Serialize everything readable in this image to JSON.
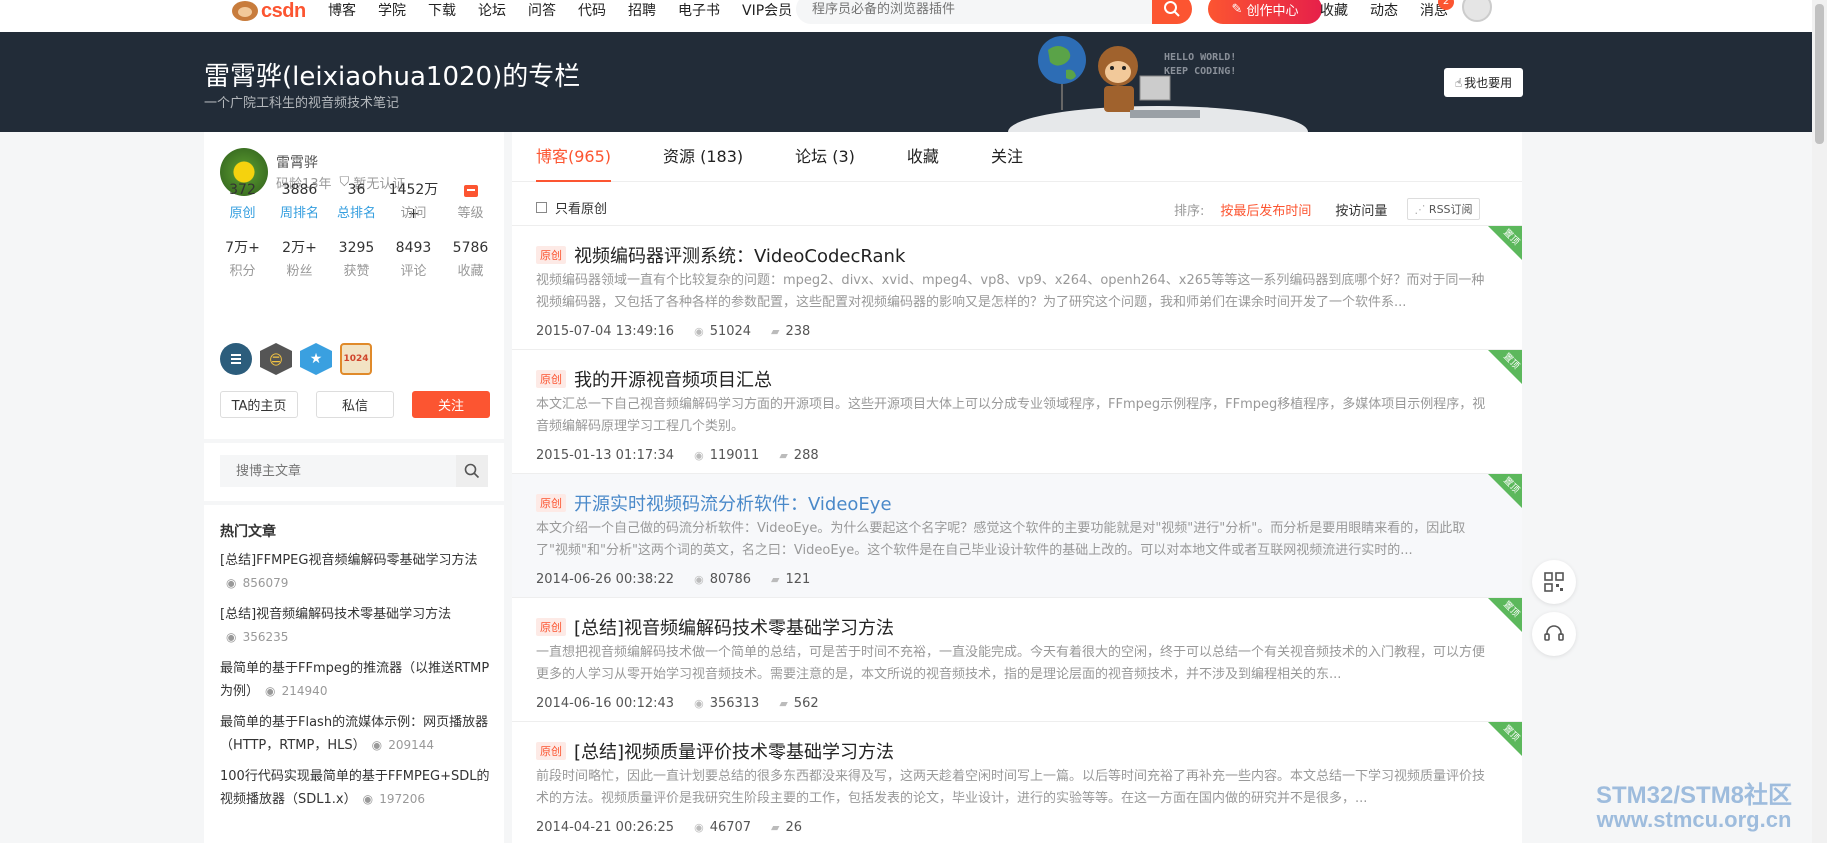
{
  "topbar": {
    "logo_text": "csdn",
    "nav": [
      "博客",
      "学院",
      "下载",
      "论坛",
      "问答",
      "代码",
      "招聘",
      "电子书",
      "VIP会员"
    ],
    "search_placeholder": "程序员必备的浏览器插件",
    "create_label": "创作中心",
    "right": [
      "收藏",
      "动态",
      "消息"
    ],
    "msg_count": "2"
  },
  "banner": {
    "title": "雷霄骅(leixiaohua1020)的专栏",
    "subtitle": "一个广院工科生的视音频技术笔记",
    "art_line1": "HELLO WORLD!",
    "art_line2": "KEEP CODING!",
    "btn": "我也要用"
  },
  "profile": {
    "name": "雷霄骅",
    "years": "码龄13年",
    "cert": "暂无认证",
    "stats1": [
      {
        "n": "372",
        "l": "原创"
      },
      {
        "n": "3886",
        "l": "周排名"
      },
      {
        "n": "36",
        "l": "总排名"
      },
      {
        "n": "1452万+",
        "l": "访问"
      },
      {
        "n": "",
        "l": "等级"
      }
    ],
    "stats2": [
      {
        "n": "7万+",
        "l": "积分"
      },
      {
        "n": "2万+",
        "l": "粉丝"
      },
      {
        "n": "3295",
        "l": "获赞"
      },
      {
        "n": "8493",
        "l": "评论"
      },
      {
        "n": "5786",
        "l": "收藏"
      }
    ],
    "btn_home": "TA的主页",
    "btn_msg": "私信",
    "btn_follow": "关注"
  },
  "blog_search": {
    "placeholder": "搜博主文章"
  },
  "hot": {
    "title": "热门文章",
    "items": [
      {
        "t": "[总结]FFMPEG视音频编解码零基础学习方法",
        "v": "856079"
      },
      {
        "t": "[总结]视音频编解码技术零基础学习方法",
        "v": "356235"
      },
      {
        "t": "最简单的基于FFmpeg的推流器（以推送RTMP为例）",
        "v": "214940"
      },
      {
        "t": "最简单的基于Flash的流媒体示例：网页播放器（HTTP，RTMP，HLS）",
        "v": "209144"
      },
      {
        "t": "100行代码实现最简单的基于FFMPEG+SDL的视频播放器（SDL1.x）",
        "v": "197206"
      }
    ]
  },
  "tabs": [
    "博客(965)",
    "资源 (183)",
    "论坛 (3)",
    "收藏",
    "关注"
  ],
  "filter": {
    "only_original": "只看原创",
    "sort_label": "排序:",
    "sort_active": "按最后发布时间",
    "sort_other": "按访问量",
    "rss": "RSS订阅"
  },
  "articles": [
    {
      "tag": "原创",
      "title": "视频编码器评测系统：VideoCodecRank",
      "desc": "视频编码器领域一直有个比较复杂的问题：mpeg2、divx、xvid、mpeg4、vp8、vp9、x264、openh264、x265等等这一系列编码器到底哪个好？而对于同一种视频编码器，又包括了各种各样的参数配置，这些配置对视频编码器的影响又是怎样的？为了研究这个问题，我和师弟们在课余时间开发了一个软件系...",
      "date": "2015-07-04 13:49:16",
      "views": "51024",
      "comments": "238",
      "corner": "置顶"
    },
    {
      "tag": "原创",
      "title": "我的开源视音频项目汇总",
      "desc": "本文汇总一下自己视音频编解码学习方面的开源项目。这些开源项目大体上可以分成专业领域程序，FFmpeg示例程序，FFmpeg移植程序，多媒体项目示例程序，视音频编解码原理学习工程几个类别。",
      "date": "2015-01-13 01:17:34",
      "views": "119011",
      "comments": "288",
      "corner": "置顶"
    },
    {
      "tag": "原创",
      "title": "开源实时视频码流分析软件：VideoEye",
      "desc": "本文介绍一个自己做的码流分析软件：VideoEye。为什么要起这个名字呢？感觉这个软件的主要功能就是对\"视频\"进行\"分析\"。而分析是要用眼睛来看的，因此取了\"视频\"和\"分析\"这两个词的英文，名之曰：VideoEye。这个软件是在自己毕业设计软件的基础上改的。可以对本地文件或者互联网视频流进行实时的...",
      "date": "2014-06-26 00:38:22",
      "views": "80786",
      "comments": "121",
      "corner": "置顶"
    },
    {
      "tag": "原创",
      "title": "[总结]视音频编解码技术零基础学习方法",
      "desc": "一直想把视音频编解码技术做一个简单的总结，可是苦于时间不充裕，一直没能完成。今天有着很大的空闲，终于可以总结一个有关视音频技术的入门教程，可以方便更多的人学习从零开始学习视音频技术。需要注意的是，本文所说的视音频技术，指的是理论层面的视音频技术，并不涉及到编程相关的东...",
      "date": "2014-06-16 00:12:43",
      "views": "356313",
      "comments": "562",
      "corner": "置顶"
    },
    {
      "tag": "原创",
      "title": "[总结]视频质量评价技术零基础学习方法",
      "desc": "前段时间略忙，因此一直计划要总结的很多东西都没来得及写，这两天趁着空闲时间写上一篇。以后等时间充裕了再补充一些内容。本文总结一下学习视频质量评价技术的方法。视频质量评价是我研究生阶段主要的工作，包括发表的论文，毕业设计，进行的实验等等。在这一方面在国内做的研究并不是很多，...",
      "date": "2014-04-21 00:26:25",
      "views": "46707",
      "comments": "26",
      "corner": "置顶"
    }
  ],
  "watermark": {
    "line1": "STM32/STM8社区",
    "line2": "www.stmcu.org.cn"
  },
  "colors": {
    "accent": "#fc5531",
    "banner_bg": "#222c38",
    "link_blue": "#349edf",
    "corner_green": "#5cb85c"
  }
}
